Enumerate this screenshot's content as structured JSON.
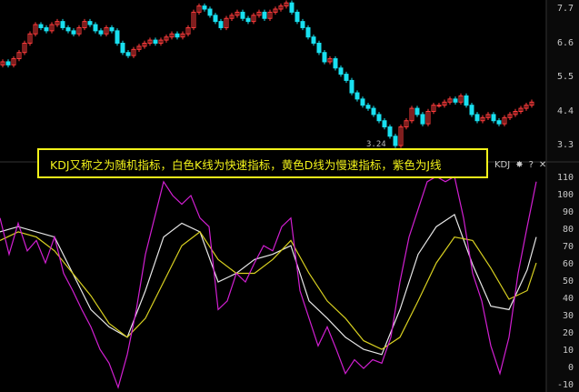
{
  "tooltip": "KDJ又称之为随机指标，白色K线为快速指标，黄色D线为慢速指标，紫色为J线",
  "indicator": {
    "name": "KDJ",
    "icons": [
      "gear-icon",
      "help-icon",
      "close-icon"
    ],
    "help": "?",
    "close": "✕",
    "gear": "✸"
  },
  "low_label": "3.24",
  "chart_data": [
    {
      "type": "candlestick",
      "title": "",
      "ylim": [
        3.1,
        7.9
      ],
      "y_ticks": [
        "7.7",
        "6.6",
        "5.5",
        "4.4",
        "3.3"
      ],
      "closes": [
        6.0,
        5.9,
        6.1,
        6.3,
        6.6,
        6.9,
        7.2,
        7.1,
        7.0,
        7.2,
        7.3,
        7.1,
        7.0,
        6.9,
        7.1,
        7.3,
        7.2,
        7.0,
        6.9,
        7.1,
        7.0,
        6.6,
        6.3,
        6.2,
        6.4,
        6.5,
        6.6,
        6.7,
        6.6,
        6.7,
        6.8,
        6.9,
        6.8,
        6.9,
        7.1,
        7.6,
        7.8,
        7.7,
        7.5,
        7.3,
        7.1,
        7.4,
        7.5,
        7.6,
        7.4,
        7.3,
        7.5,
        7.6,
        7.4,
        7.6,
        7.7,
        7.8,
        7.9,
        7.6,
        7.3,
        7.1,
        6.8,
        6.6,
        6.3,
        6.0,
        6.1,
        5.8,
        5.6,
        5.4,
        5.0,
        4.8,
        4.6,
        4.5,
        4.3,
        4.1,
        3.9,
        3.6,
        3.3,
        3.9,
        4.1,
        4.5,
        4.3,
        4.0,
        4.4,
        4.6,
        4.6,
        4.7,
        4.8,
        4.7,
        4.9,
        4.6,
        4.3,
        4.1,
        4.2,
        4.3,
        4.1,
        4.0,
        4.2,
        4.3,
        4.4,
        4.5,
        4.6,
        4.7
      ],
      "colors": {
        "up": "#ff3b3b",
        "down": "#19e0f0"
      }
    },
    {
      "type": "line",
      "title": "KDJ",
      "ylim": [
        -12,
        118
      ],
      "y_ticks": [
        "110",
        "100",
        "90",
        "80",
        "70",
        "60",
        "50",
        "40",
        "30",
        "20",
        "10",
        "0",
        "-10"
      ],
      "series": [
        {
          "name": "K",
          "color": "#e8e8e8",
          "t": [
            0,
            2,
            4,
            6,
            8,
            10,
            12,
            14,
            16,
            18,
            20,
            22,
            24,
            26,
            28,
            30,
            32,
            34,
            36,
            38,
            40,
            42,
            44,
            46,
            48,
            50,
            52,
            54,
            56,
            58,
            59
          ],
          "values": [
            79,
            82,
            79,
            76,
            55,
            34,
            24,
            18,
            45,
            76,
            84,
            79,
            50,
            55,
            63,
            66,
            71,
            39,
            29,
            18,
            11,
            8,
            34,
            66,
            82,
            89,
            60,
            36,
            34,
            57,
            76
          ]
        },
        {
          "name": "D",
          "color": "#d8d020",
          "t": [
            0,
            2,
            4,
            6,
            8,
            10,
            12,
            14,
            16,
            18,
            20,
            22,
            24,
            26,
            28,
            30,
            32,
            34,
            36,
            38,
            40,
            42,
            44,
            46,
            48,
            50,
            52,
            54,
            56,
            58,
            59
          ],
          "values": [
            74,
            79,
            76,
            68,
            55,
            42,
            26,
            18,
            29,
            50,
            71,
            79,
            63,
            55,
            55,
            63,
            74,
            55,
            39,
            29,
            16,
            11,
            18,
            39,
            61,
            76,
            74,
            58,
            40,
            45,
            61
          ]
        },
        {
          "name": "J",
          "color": "#d21fd2",
          "t": [
            0,
            1,
            2,
            3,
            4,
            5,
            6,
            7,
            8,
            9,
            10,
            11,
            12,
            13,
            14,
            15,
            16,
            17,
            18,
            19,
            20,
            21,
            22,
            23,
            24,
            25,
            26,
            27,
            28,
            29,
            30,
            31,
            32,
            33,
            34,
            35,
            36,
            37,
            38,
            39,
            40,
            41,
            42,
            43,
            44,
            45,
            46,
            47,
            48,
            49,
            50,
            51,
            52,
            53,
            54,
            55,
            56,
            57,
            58,
            59
          ],
          "values": [
            87,
            66,
            84,
            68,
            74,
            61,
            76,
            55,
            45,
            34,
            24,
            11,
            3,
            -11,
            8,
            34,
            66,
            87,
            108,
            100,
            95,
            100,
            87,
            82,
            34,
            39,
            55,
            50,
            61,
            71,
            68,
            82,
            87,
            45,
            29,
            13,
            24,
            11,
            -3,
            5,
            0,
            5,
            3,
            18,
            50,
            76,
            92,
            108,
            111,
            108,
            111,
            87,
            55,
            39,
            13,
            -3,
            18,
            55,
            82,
            108
          ]
        }
      ]
    }
  ]
}
